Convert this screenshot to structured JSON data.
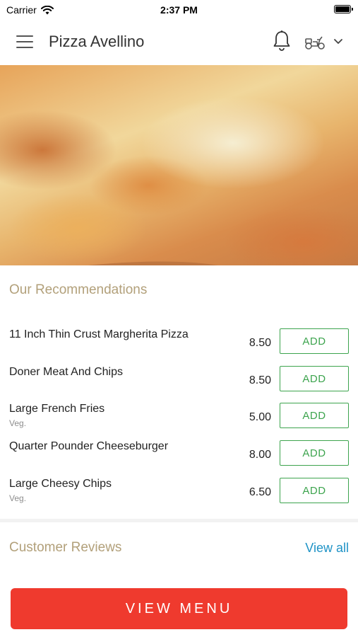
{
  "status_bar": {
    "carrier": "Carrier",
    "time": "2:37 PM"
  },
  "app_bar": {
    "title": "Pizza Avellino",
    "icons": [
      "menu-icon",
      "bell-icon",
      "scooter-icon",
      "chevron-down-icon"
    ]
  },
  "hero": {
    "image": "pizza-photo"
  },
  "recommendations": {
    "title": "Our Recommendations",
    "items": [
      {
        "name": "11 Inch Thin Crust Margherita Pizza",
        "note": "",
        "price": "8.50",
        "button": "ADD"
      },
      {
        "name": "Doner Meat And Chips",
        "note": "",
        "price": "8.50",
        "button": "ADD"
      },
      {
        "name": "Large French Fries",
        "note": "Veg.",
        "price": "5.00",
        "button": "ADD"
      },
      {
        "name": "Quarter Pounder Cheeseburger",
        "note": "",
        "price": "8.00",
        "button": "ADD"
      },
      {
        "name": "Large Cheesy Chips",
        "note": "Veg.",
        "price": "6.50",
        "button": "ADD"
      }
    ]
  },
  "reviews": {
    "title": "Customer Reviews",
    "view_all": "View all"
  },
  "footer": {
    "view_menu": "VIEW MENU"
  },
  "colors": {
    "accent_red": "#ef3a2e",
    "add_green": "#3da44e",
    "section_title": "#b2a07a",
    "link_blue": "#1f93c6"
  }
}
